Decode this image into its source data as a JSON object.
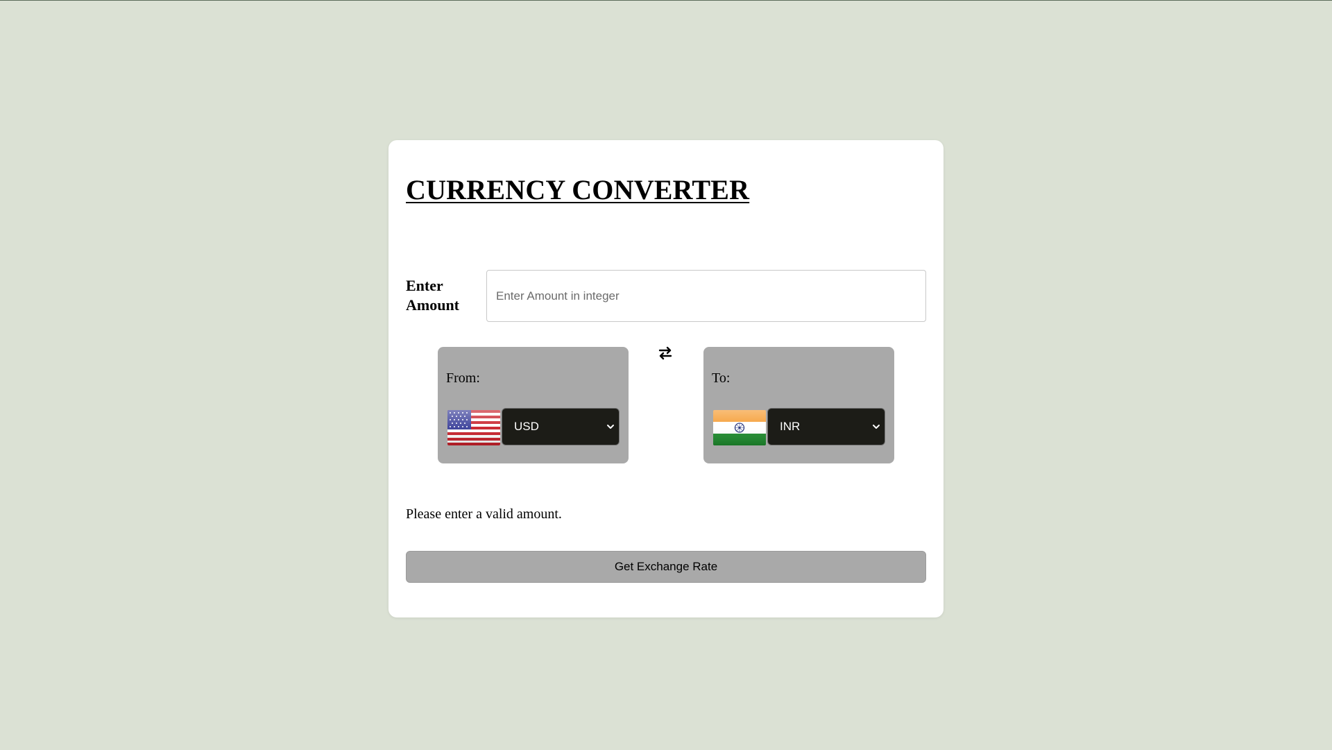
{
  "converter": {
    "title": "CURRENCY CONVERTER",
    "amount_label": "Enter Amount",
    "amount_placeholder": "Enter Amount in integer",
    "amount_value": "",
    "from": {
      "label": "From:",
      "currency": "USD",
      "flag_icon": "us-flag-icon"
    },
    "to": {
      "label": "To:",
      "currency": "INR",
      "flag_icon": "india-flag-icon"
    },
    "swap_icon": "swap-arrows-icon",
    "message": "Please enter a valid amount.",
    "button_label": "Get Exchange Rate"
  },
  "colors": {
    "page_background": "#dbe1d4",
    "card_background": "#ffffff",
    "panel_background": "#a9a9a9",
    "select_background": "#1c1c17",
    "button_background": "#a9a9a9"
  }
}
